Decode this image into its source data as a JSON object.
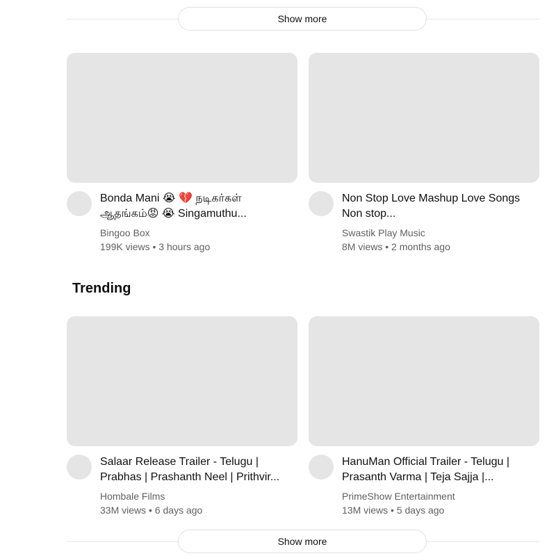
{
  "show_more_label": "Show more",
  "section_title": "Trending",
  "row1": [
    {
      "title": "Bonda Mani 😭 💔 நடிகர்கள் ஆதங்கம்😡 😭 Singamuthu...",
      "channel": "Bingoo Box",
      "views": "199K views",
      "age": "3 hours ago"
    },
    {
      "title": "Non Stop Love Mashup Love Songs Non stop...",
      "channel": "Swastik Play Music",
      "views": "8M views",
      "age": "2 months ago"
    }
  ],
  "row2": [
    {
      "title": "Salaar Release Trailer - Telugu | Prabhas | Prashanth Neel | Prithvir...",
      "channel": "Hombale Films",
      "views": "33M views",
      "age": "6 days ago"
    },
    {
      "title": "HanuMan Official Trailer - Telugu | Prasanth Varma | Teja Sajja |...",
      "channel": "PrimeShow Entertainment",
      "views": "13M views",
      "age": "5 days ago"
    }
  ],
  "stats_separator": " • "
}
